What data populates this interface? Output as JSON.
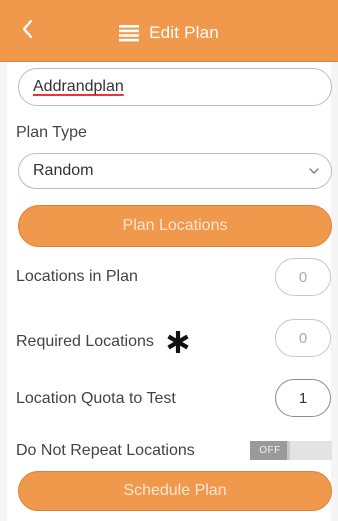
{
  "header": {
    "title": "Edit Plan",
    "back_icon": "chevron-left-icon",
    "menu_icon": "list-icon",
    "color": "#f0984b"
  },
  "form": {
    "plan_name_value": "Addrandplan",
    "plan_type_label": "Plan Type",
    "plan_type_value": "Random",
    "plan_locations_button": "Plan Locations",
    "locations_in_plan_label": "Locations in Plan",
    "locations_in_plan_value": "0",
    "required_locations_label": "Required Locations",
    "required_locations_value": "0",
    "location_quota_label": "Location Quota to Test",
    "location_quota_value": "1",
    "do_not_repeat_label": "Do Not Repeat Locations",
    "do_not_repeat_toggle": "OFF",
    "schedule_plan_button": "Schedule Plan"
  }
}
